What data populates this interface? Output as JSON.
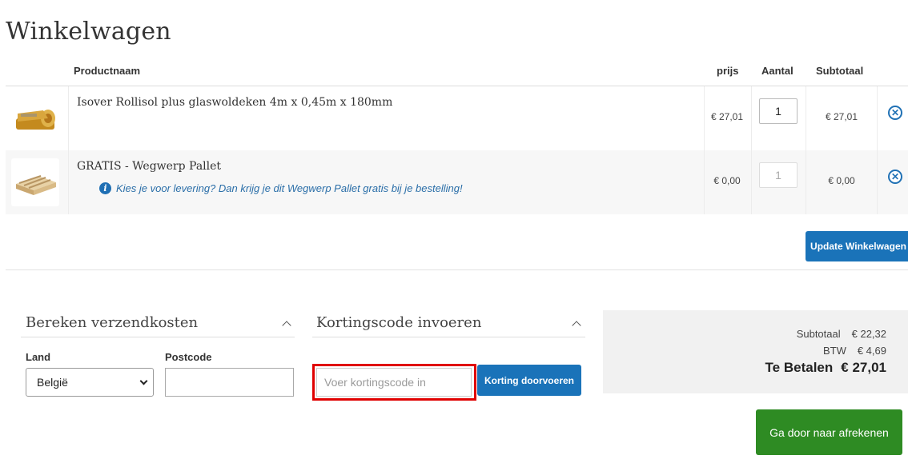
{
  "page": {
    "title": "Winkelwagen"
  },
  "table": {
    "headers": {
      "product": "Productnaam",
      "price": "prijs",
      "qty": "Aantal",
      "subtotal": "Subtotaal"
    },
    "rows": [
      {
        "name": "Isover Rollisol plus glaswoldeken 4m x 0,45m x 180mm",
        "price": "€ 27,01",
        "qty": "1",
        "subtotal": "€ 27,01",
        "thumb": "insulation-roll-image"
      },
      {
        "name": "GRATIS - Wegwerp Pallet",
        "note": "Kies je voor levering? Dan krijg je dit Wegwerp Pallet gratis bij je bestelling!",
        "price": "€ 0,00",
        "qty": "1",
        "subtotal": "€ 0,00",
        "thumb": "pallet-image"
      }
    ],
    "update_button": "Update Winkelwagen"
  },
  "shipping": {
    "title": "Bereken verzendkosten",
    "country_label": "Land",
    "country_value": "België",
    "postcode_label": "Postcode",
    "postcode_value": ""
  },
  "coupon": {
    "title": "Kortingscode invoeren",
    "placeholder": "Voer kortingscode in",
    "apply_button": "Korting doorvoeren"
  },
  "totals": {
    "subtotal_label": "Subtotaal",
    "subtotal_value": "€ 22,32",
    "tax_label": "BTW",
    "tax_value": "€ 4,69",
    "total_label": "Te Betalen",
    "total_value": "€ 27,01"
  },
  "checkout_button": "Ga door naar afrekenen",
  "colors": {
    "primary": "#1a73b9",
    "checkout": "#2e8b23",
    "highlight": "#e00000"
  }
}
